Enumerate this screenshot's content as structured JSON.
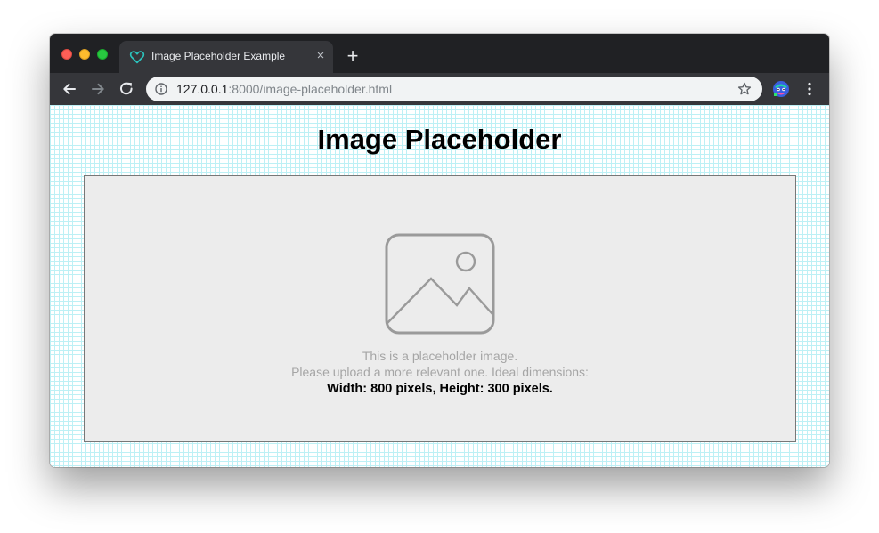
{
  "browser": {
    "tab": {
      "title": "Image Placeholder Example",
      "favicon": "heart-outline-icon",
      "favicon_color": "#2bc3bd",
      "close_glyph": "×"
    },
    "new_tab_glyph": "+",
    "address_bar": {
      "host": "127.0.0.1",
      "path": ":8000/image-placeholder.html"
    },
    "window_controls": [
      "close",
      "minimize",
      "maximize"
    ]
  },
  "page": {
    "title": "Image Placeholder",
    "placeholder": {
      "line1": "This is a placeholder image.",
      "line2": "Please upload a more relevant one. Ideal dimensions:",
      "line3": "Width: 800 pixels, Height: 300 pixels."
    }
  },
  "colors": {
    "grid": "#bdf0f5",
    "placeholder_bg": "#ececec",
    "muted_text": "#a5a5a5",
    "chrome_dark": "#202124",
    "toolbar": "#35363a"
  }
}
